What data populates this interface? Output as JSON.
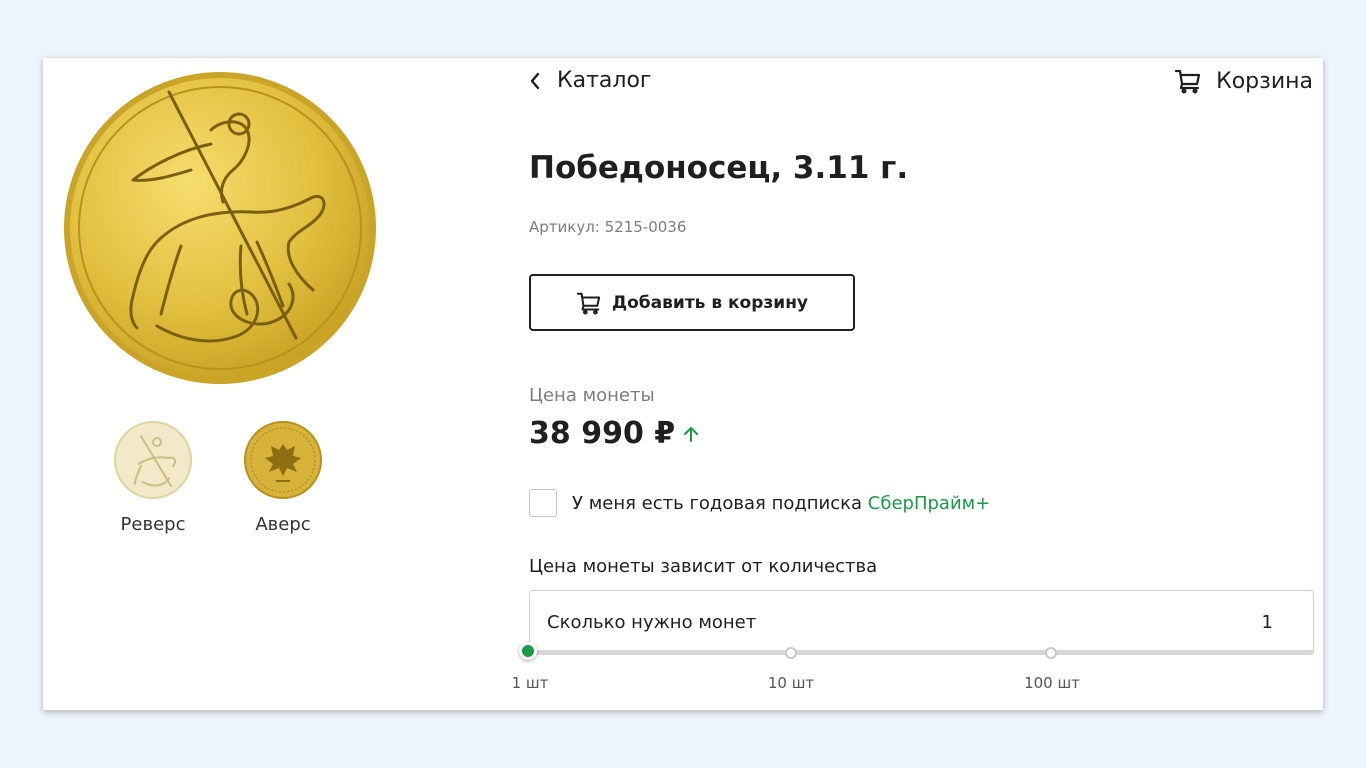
{
  "nav": {
    "back_label": "Каталог",
    "cart_label": "Корзина"
  },
  "product": {
    "title": "Победоносец, 3.11 г.",
    "sku": "Артикул: 5215-0036",
    "add_to_cart_label": "Добавить в корзину",
    "price_label": "Цена монеты",
    "price": "38 990 ₽",
    "price_trend": "up"
  },
  "gallery": {
    "thumbnails": [
      {
        "label": "Реверс"
      },
      {
        "label": "Аверс"
      }
    ]
  },
  "subscription": {
    "text": "У меня есть годовая подписка ",
    "link": "СберПрайм+",
    "checked": false
  },
  "quantity": {
    "section_label": "Цена монеты зависит от количества",
    "label": "Сколько нужно монет",
    "value": "1",
    "slider_ticks": [
      "1 шт",
      "10 шт",
      "100 шт"
    ]
  },
  "colors": {
    "accent_green": "#1a9b46",
    "gold": "#d9b73a",
    "background": "#eef4fd"
  }
}
